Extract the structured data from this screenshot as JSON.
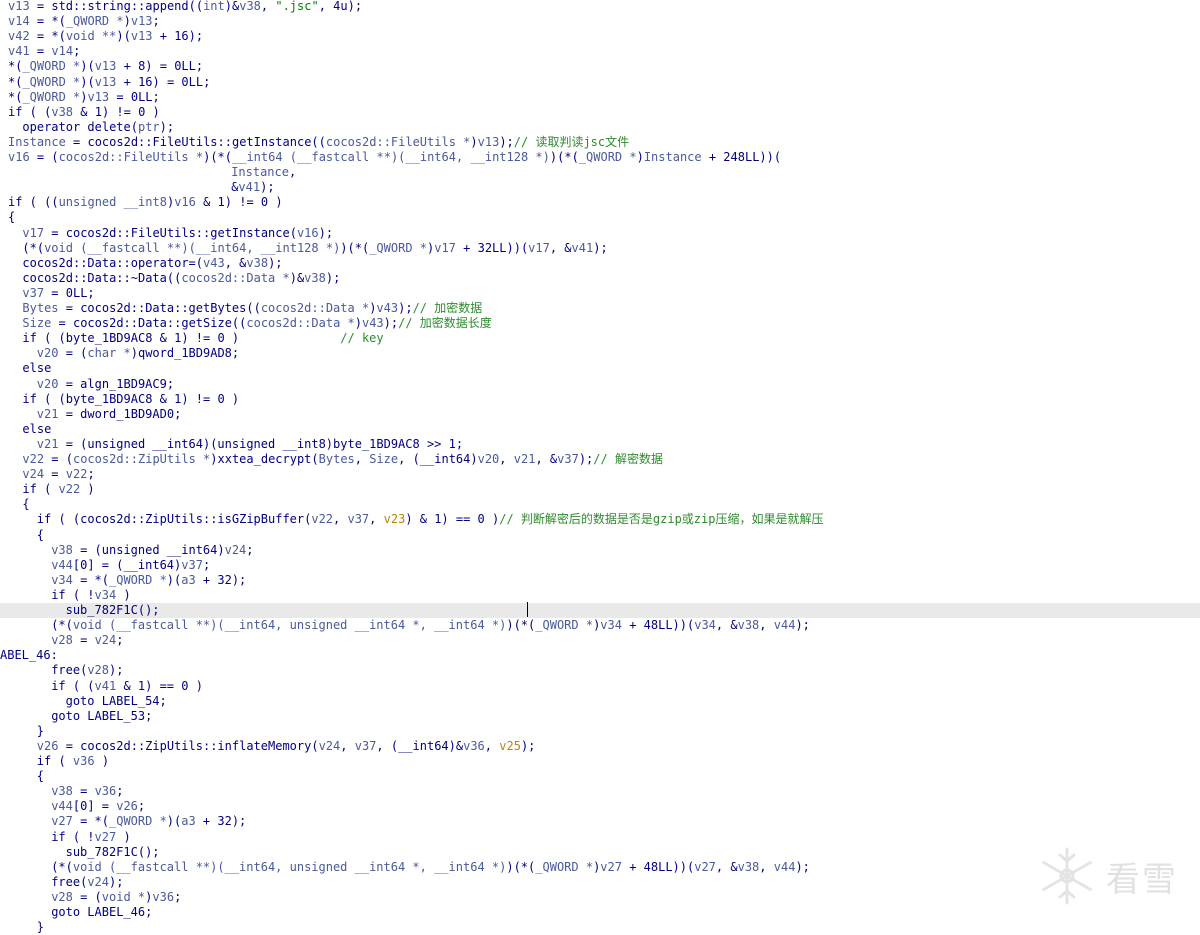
{
  "caret_line_index": 40,
  "watermark": {
    "text": "看雪"
  },
  "colors": {
    "default": "#000080",
    "identifier": "#4a5a9a",
    "string": "#008000",
    "comment": "#2e8b2e",
    "highlight_line": "#e9e9e9",
    "warning": "#b8860b"
  },
  "lines": [
    {
      "indent": 0,
      "tokens": [
        [
          "v13",
          "var"
        ],
        [
          " = std::string::append((",
          "fn"
        ],
        [
          "int",
          "type"
        ],
        [
          ")&",
          "fn"
        ],
        [
          "v38",
          "var"
        ],
        [
          ", ",
          "fn"
        ],
        [
          "\".jsc\"",
          "str"
        ],
        [
          ", 4u);",
          "fn"
        ]
      ]
    },
    {
      "indent": 0,
      "tokens": [
        [
          "v14",
          "var"
        ],
        [
          " = *(",
          "fn"
        ],
        [
          "_QWORD *",
          "type"
        ],
        [
          ")",
          "fn"
        ],
        [
          "v13",
          "var"
        ],
        [
          ";",
          "fn"
        ]
      ]
    },
    {
      "indent": 0,
      "tokens": [
        [
          "v42",
          "var"
        ],
        [
          " = *(",
          "fn"
        ],
        [
          "void **",
          "type"
        ],
        [
          ")(",
          "fn"
        ],
        [
          "v13",
          "var"
        ],
        [
          " + 16);",
          "fn"
        ]
      ]
    },
    {
      "indent": 0,
      "tokens": [
        [
          "v41",
          "var"
        ],
        [
          " = ",
          "fn"
        ],
        [
          "v14",
          "var"
        ],
        [
          ";",
          "fn"
        ]
      ]
    },
    {
      "indent": 0,
      "tokens": [
        [
          "*(",
          "fn"
        ],
        [
          "_QWORD *",
          "type"
        ],
        [
          ")(",
          "fn"
        ],
        [
          "v13",
          "var"
        ],
        [
          " + 8) = 0LL;",
          "fn"
        ]
      ]
    },
    {
      "indent": 0,
      "tokens": [
        [
          "*(",
          "fn"
        ],
        [
          "_QWORD *",
          "type"
        ],
        [
          ")(",
          "fn"
        ],
        [
          "v13",
          "var"
        ],
        [
          " + 16) = 0LL;",
          "fn"
        ]
      ]
    },
    {
      "indent": 0,
      "tokens": [
        [
          "*(",
          "fn"
        ],
        [
          "_QWORD *",
          "type"
        ],
        [
          ")",
          "fn"
        ],
        [
          "v13",
          "var"
        ],
        [
          " = 0LL;",
          "fn"
        ]
      ]
    },
    {
      "indent": 0,
      "tokens": [
        [
          "if ( (",
          "kw"
        ],
        [
          "v38",
          "var"
        ],
        [
          " & 1) != 0 )",
          "fn"
        ]
      ]
    },
    {
      "indent": 2,
      "tokens": [
        [
          "operator delete(",
          "fn"
        ],
        [
          "ptr",
          "var"
        ],
        [
          ");",
          "fn"
        ]
      ]
    },
    {
      "indent": 0,
      "tokens": [
        [
          "Instance",
          "var"
        ],
        [
          " = cocos2d::FileUtils::getInstance((",
          "fn"
        ],
        [
          "cocos2d::FileUtils *",
          "type"
        ],
        [
          ")",
          "fn"
        ],
        [
          "v13",
          "var"
        ],
        [
          ");",
          "fn"
        ],
        [
          "// 读取判读jsc文件",
          "cm"
        ]
      ]
    },
    {
      "indent": 0,
      "tokens": [
        [
          "v16",
          "var"
        ],
        [
          " = (",
          "fn"
        ],
        [
          "cocos2d::FileUtils *",
          "type"
        ],
        [
          ")(*(",
          "fn"
        ],
        [
          "__int64 (__fastcall **)(__int64, __int128 *)",
          "type"
        ],
        [
          ")(*(",
          "fn"
        ],
        [
          "_QWORD *",
          "type"
        ],
        [
          ")",
          "fn"
        ],
        [
          "Instance",
          "var"
        ],
        [
          " + 248LL))(",
          "fn"
        ]
      ]
    },
    {
      "indent": 31,
      "tokens": [
        [
          "Instance",
          "var"
        ],
        [
          ",",
          "fn"
        ]
      ]
    },
    {
      "indent": 31,
      "tokens": [
        [
          "&",
          "fn"
        ],
        [
          "v41",
          "var"
        ],
        [
          ");",
          "fn"
        ]
      ]
    },
    {
      "indent": 0,
      "tokens": [
        [
          "if ( ((",
          "kw"
        ],
        [
          "unsigned __int8",
          "type"
        ],
        [
          ")",
          "fn"
        ],
        [
          "v16",
          "var"
        ],
        [
          " & 1) != 0 )",
          "fn"
        ]
      ]
    },
    {
      "indent": 0,
      "tokens": [
        [
          "{",
          "fn"
        ]
      ]
    },
    {
      "indent": 2,
      "tokens": [
        [
          "v17",
          "var"
        ],
        [
          " = cocos2d::FileUtils::getInstance(",
          "fn"
        ],
        [
          "v16",
          "var"
        ],
        [
          ");",
          "fn"
        ]
      ]
    },
    {
      "indent": 2,
      "tokens": [
        [
          "(*(",
          "fn"
        ],
        [
          "void (__fastcall **)(__int64, __int128 *)",
          "type"
        ],
        [
          ")(*(",
          "fn"
        ],
        [
          "_QWORD *",
          "type"
        ],
        [
          ")",
          "fn"
        ],
        [
          "v17",
          "var"
        ],
        [
          " + 32LL))(",
          "fn"
        ],
        [
          "v17",
          "var"
        ],
        [
          ", &",
          "fn"
        ],
        [
          "v41",
          "var"
        ],
        [
          ");",
          "fn"
        ]
      ]
    },
    {
      "indent": 2,
      "tokens": [
        [
          "cocos2d::Data::operator=(",
          "fn"
        ],
        [
          "v43",
          "var"
        ],
        [
          ", &",
          "fn"
        ],
        [
          "v38",
          "var"
        ],
        [
          ");",
          "fn"
        ]
      ]
    },
    {
      "indent": 2,
      "tokens": [
        [
          "cocos2d::Data::~Data((",
          "fn"
        ],
        [
          "cocos2d::Data *",
          "type"
        ],
        [
          ")&",
          "fn"
        ],
        [
          "v38",
          "var"
        ],
        [
          ");",
          "fn"
        ]
      ]
    },
    {
      "indent": 2,
      "tokens": [
        [
          "v37",
          "var"
        ],
        [
          " = 0LL;",
          "fn"
        ]
      ]
    },
    {
      "indent": 2,
      "tokens": [
        [
          "Bytes",
          "var"
        ],
        [
          " = cocos2d::Data::getBytes((",
          "fn"
        ],
        [
          "cocos2d::Data *",
          "type"
        ],
        [
          ")",
          "fn"
        ],
        [
          "v43",
          "var"
        ],
        [
          ");",
          "fn"
        ],
        [
          "// 加密数据",
          "cm"
        ]
      ]
    },
    {
      "indent": 2,
      "tokens": [
        [
          "Size",
          "var"
        ],
        [
          " = cocos2d::Data::getSize((",
          "fn"
        ],
        [
          "cocos2d::Data *",
          "type"
        ],
        [
          ")",
          "fn"
        ],
        [
          "v43",
          "var"
        ],
        [
          ");",
          "fn"
        ],
        [
          "// 加密数据长度",
          "cm"
        ]
      ]
    },
    {
      "indent": 2,
      "tokens": [
        [
          "if ( (byte_1BD9AC8 & 1) != 0 )",
          "kw"
        ],
        [
          "              // key",
          "cm"
        ]
      ]
    },
    {
      "indent": 4,
      "tokens": [
        [
          "v20",
          "var"
        ],
        [
          " = (",
          "fn"
        ],
        [
          "char *",
          "type"
        ],
        [
          ")qword_1BD9AD8;",
          "fn"
        ]
      ]
    },
    {
      "indent": 2,
      "tokens": [
        [
          "else",
          "kw"
        ]
      ]
    },
    {
      "indent": 4,
      "tokens": [
        [
          "v20",
          "var"
        ],
        [
          " = algn_1BD9AC9;",
          "fn"
        ]
      ]
    },
    {
      "indent": 2,
      "tokens": [
        [
          "if ( (byte_1BD9AC8 & 1) != 0 )",
          "kw"
        ]
      ]
    },
    {
      "indent": 4,
      "tokens": [
        [
          "v21",
          "var"
        ],
        [
          " = dword_1BD9AD0;",
          "fn"
        ]
      ]
    },
    {
      "indent": 2,
      "tokens": [
        [
          "else",
          "kw"
        ]
      ]
    },
    {
      "indent": 4,
      "tokens": [
        [
          "v21",
          "var"
        ],
        [
          " = (unsigned __int64)(unsigned __int8)byte_1BD9AC8 >> 1;",
          "fn"
        ]
      ]
    },
    {
      "indent": 2,
      "tokens": [
        [
          "v22",
          "var"
        ],
        [
          " = (",
          "fn"
        ],
        [
          "cocos2d::ZipUtils *",
          "type"
        ],
        [
          ")xxtea_decrypt(",
          "fn"
        ],
        [
          "Bytes",
          "var"
        ],
        [
          ", ",
          "fn"
        ],
        [
          "Size",
          "var"
        ],
        [
          ", (__int64)",
          "fn"
        ],
        [
          "v20",
          "var"
        ],
        [
          ", ",
          "fn"
        ],
        [
          "v21",
          "var"
        ],
        [
          ", &",
          "fn"
        ],
        [
          "v37",
          "var"
        ],
        [
          ");",
          "fn"
        ],
        [
          "// 解密数据",
          "cm"
        ]
      ]
    },
    {
      "indent": 2,
      "tokens": [
        [
          "v24",
          "var"
        ],
        [
          " = ",
          "fn"
        ],
        [
          "v22",
          "var"
        ],
        [
          ";",
          "fn"
        ]
      ]
    },
    {
      "indent": 2,
      "tokens": [
        [
          "if ( ",
          "kw"
        ],
        [
          "v22",
          "var"
        ],
        [
          " )",
          "fn"
        ]
      ]
    },
    {
      "indent": 2,
      "tokens": [
        [
          "{",
          "fn"
        ]
      ]
    },
    {
      "indent": 4,
      "tokens": [
        [
          "if ( (",
          "kw"
        ],
        [
          "cocos2d::ZipUtils::isGZipBuffer(",
          "fn"
        ],
        [
          "v22",
          "var"
        ],
        [
          ", ",
          "fn"
        ],
        [
          "v37",
          "var"
        ],
        [
          ", ",
          "fn"
        ],
        [
          "v23",
          "warn"
        ],
        [
          ") & 1) == 0 )",
          "fn"
        ],
        [
          "// 判断解密后的数据是否是gzip或zip压缩，如果是就解压",
          "cm"
        ]
      ]
    },
    {
      "indent": 4,
      "tokens": [
        [
          "{",
          "fn"
        ]
      ]
    },
    {
      "indent": 6,
      "tokens": [
        [
          "v38",
          "var"
        ],
        [
          " = (unsigned __int64)",
          "fn"
        ],
        [
          "v24",
          "var"
        ],
        [
          ";",
          "fn"
        ]
      ]
    },
    {
      "indent": 6,
      "tokens": [
        [
          "v44",
          "var"
        ],
        [
          "[0] = (__int64)",
          "fn"
        ],
        [
          "v37",
          "var"
        ],
        [
          ";",
          "fn"
        ]
      ]
    },
    {
      "indent": 6,
      "tokens": [
        [
          "v34",
          "var"
        ],
        [
          " = *(",
          "fn"
        ],
        [
          "_QWORD *",
          "type"
        ],
        [
          ")(",
          "fn"
        ],
        [
          "a3",
          "var"
        ],
        [
          " + 32);",
          "fn"
        ]
      ]
    },
    {
      "indent": 6,
      "tokens": [
        [
          "if ( !",
          "kw"
        ],
        [
          "v34",
          "var"
        ],
        [
          " )",
          "fn"
        ]
      ]
    },
    {
      "indent": 8,
      "tokens": [
        [
          "sub_782F1C();",
          "fn"
        ]
      ]
    },
    {
      "indent": 6,
      "tokens": [
        [
          "(*(",
          "fn"
        ],
        [
          "void (__fastcall **)(__int64, unsigned __int64 *, __int64 *)",
          "type"
        ],
        [
          ")(*(",
          "fn"
        ],
        [
          "_QWORD *",
          "type"
        ],
        [
          ")",
          "fn"
        ],
        [
          "v34",
          "var"
        ],
        [
          " + 48LL))(",
          "fn"
        ],
        [
          "v34",
          "var"
        ],
        [
          ", &",
          "fn"
        ],
        [
          "v38",
          "var"
        ],
        [
          ", ",
          "fn"
        ],
        [
          "v44",
          "var"
        ],
        [
          ");",
          "fn"
        ]
      ]
    },
    {
      "indent": 6,
      "tokens": [
        [
          "v28",
          "var"
        ],
        [
          " = ",
          "fn"
        ],
        [
          "v24",
          "var"
        ],
        [
          ";",
          "fn"
        ]
      ]
    },
    {
      "indent": 0,
      "tokens": [
        [
          "ABEL_46:",
          "lbl"
        ]
      ]
    },
    {
      "indent": 6,
      "tokens": [
        [
          "free(",
          "fn"
        ],
        [
          "v28",
          "var"
        ],
        [
          ");",
          "fn"
        ]
      ]
    },
    {
      "indent": 6,
      "tokens": [
        [
          "if ( (",
          "kw"
        ],
        [
          "v41",
          "var"
        ],
        [
          " & 1) == 0 )",
          "fn"
        ]
      ]
    },
    {
      "indent": 8,
      "tokens": [
        [
          "goto LABEL_54;",
          "kw"
        ]
      ]
    },
    {
      "indent": 6,
      "tokens": [
        [
          "goto LABEL_53;",
          "kw"
        ]
      ]
    },
    {
      "indent": 4,
      "tokens": [
        [
          "}",
          "fn"
        ]
      ]
    },
    {
      "indent": 4,
      "tokens": [
        [
          "v26",
          "var"
        ],
        [
          " = cocos2d::ZipUtils::inflateMemory(",
          "fn"
        ],
        [
          "v24",
          "var"
        ],
        [
          ", ",
          "fn"
        ],
        [
          "v37",
          "var"
        ],
        [
          ", (__int64)&",
          "fn"
        ],
        [
          "v36",
          "var"
        ],
        [
          ", ",
          "fn"
        ],
        [
          "v25",
          "warn"
        ],
        [
          ");",
          "fn"
        ]
      ]
    },
    {
      "indent": 4,
      "tokens": [
        [
          "if ( ",
          "kw"
        ],
        [
          "v36",
          "var"
        ],
        [
          " )",
          "fn"
        ]
      ]
    },
    {
      "indent": 4,
      "tokens": [
        [
          "{",
          "fn"
        ]
      ]
    },
    {
      "indent": 6,
      "tokens": [
        [
          "v38",
          "var"
        ],
        [
          " = ",
          "fn"
        ],
        [
          "v36",
          "var"
        ],
        [
          ";",
          "fn"
        ]
      ]
    },
    {
      "indent": 6,
      "tokens": [
        [
          "v44",
          "var"
        ],
        [
          "[0] = ",
          "fn"
        ],
        [
          "v26",
          "var"
        ],
        [
          ";",
          "fn"
        ]
      ]
    },
    {
      "indent": 6,
      "tokens": [
        [
          "v27",
          "var"
        ],
        [
          " = *(",
          "fn"
        ],
        [
          "_QWORD *",
          "type"
        ],
        [
          ")(",
          "fn"
        ],
        [
          "a3",
          "var"
        ],
        [
          " + 32);",
          "fn"
        ]
      ]
    },
    {
      "indent": 6,
      "tokens": [
        [
          "if ( !",
          "kw"
        ],
        [
          "v27",
          "var"
        ],
        [
          " )",
          "fn"
        ]
      ]
    },
    {
      "indent": 8,
      "tokens": [
        [
          "sub_782F1C();",
          "fn"
        ]
      ]
    },
    {
      "indent": 6,
      "tokens": [
        [
          "(*(",
          "fn"
        ],
        [
          "void (__fastcall **)(__int64, unsigned __int64 *, __int64 *)",
          "type"
        ],
        [
          ")(*(",
          "fn"
        ],
        [
          "_QWORD *",
          "type"
        ],
        [
          ")",
          "fn"
        ],
        [
          "v27",
          "var"
        ],
        [
          " + 48LL))(",
          "fn"
        ],
        [
          "v27",
          "var"
        ],
        [
          ", &",
          "fn"
        ],
        [
          "v38",
          "var"
        ],
        [
          ", ",
          "fn"
        ],
        [
          "v44",
          "var"
        ],
        [
          ");",
          "fn"
        ]
      ]
    },
    {
      "indent": 6,
      "tokens": [
        [
          "free(",
          "fn"
        ],
        [
          "v24",
          "var"
        ],
        [
          ");",
          "fn"
        ]
      ]
    },
    {
      "indent": 6,
      "tokens": [
        [
          "v28",
          "var"
        ],
        [
          " = (",
          "fn"
        ],
        [
          "void *",
          "type"
        ],
        [
          ")",
          "fn"
        ],
        [
          "v36",
          "var"
        ],
        [
          ";",
          "fn"
        ]
      ]
    },
    {
      "indent": 6,
      "tokens": [
        [
          "goto LABEL_46;",
          "kw"
        ]
      ]
    },
    {
      "indent": 4,
      "tokens": [
        [
          "}",
          "fn"
        ]
      ]
    }
  ]
}
